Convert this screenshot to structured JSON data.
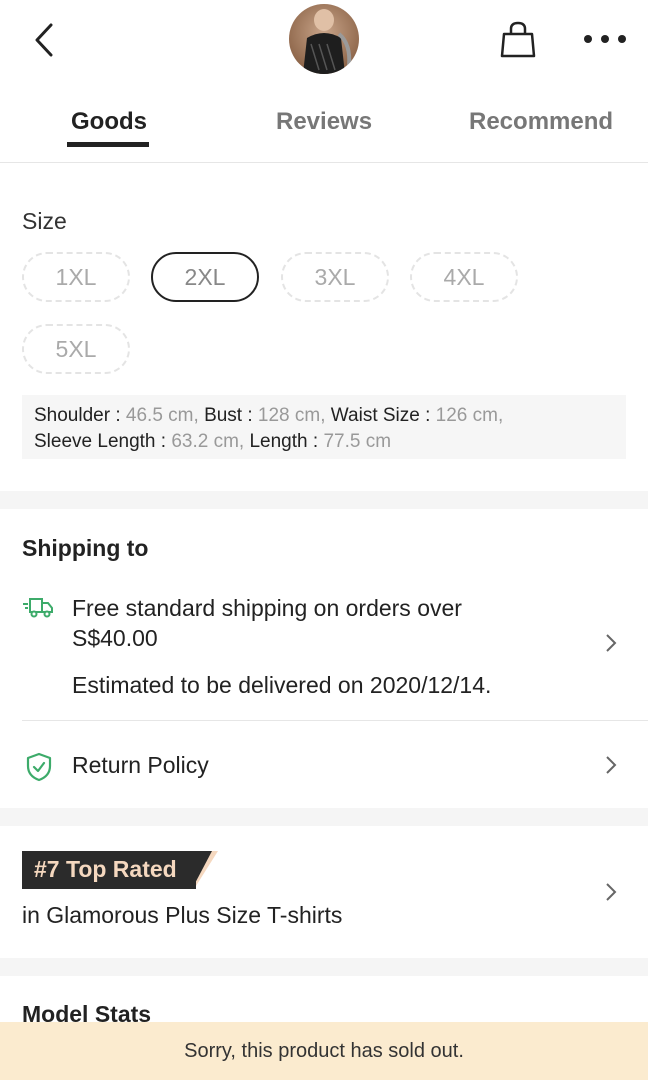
{
  "header": {
    "back_icon": "chevron-left-icon",
    "bag_icon": "shopping-bag-icon",
    "more_icon": "more-dots-icon"
  },
  "tabs": [
    {
      "label": "Goods",
      "active": true
    },
    {
      "label": "Reviews",
      "active": false
    },
    {
      "label": "Recommend",
      "active": false
    }
  ],
  "size": {
    "title": "Size",
    "options": [
      {
        "label": "1XL",
        "selected": false
      },
      {
        "label": "2XL",
        "selected": true
      },
      {
        "label": "3XL",
        "selected": false
      },
      {
        "label": "4XL",
        "selected": false
      },
      {
        "label": "5XL",
        "selected": false
      }
    ],
    "measurements": {
      "shoulder_label": "Shoulder :",
      "shoulder_value": "46.5 cm,",
      "bust_label": "Bust :",
      "bust_value": "128 cm,",
      "waist_label": "Waist Size :",
      "waist_value": "126 cm,",
      "sleeve_label": "Sleeve Length :",
      "sleeve_value": "63.2 cm,",
      "length_label": "Length :",
      "length_value": "77.5 cm"
    }
  },
  "shipping": {
    "title": "Shipping to",
    "free_shipping": "Free standard shipping on orders over S$40.00",
    "estimate": "Estimated to be delivered on 2020/12/14.",
    "return_policy": "Return Policy",
    "accent_color": "#3dab6a"
  },
  "ranking": {
    "badge": "#7 Top Rated",
    "category": "in Glamorous Plus Size T-shirts"
  },
  "model_stats": {
    "title": "Model Stats"
  },
  "sold_out": {
    "message": "Sorry, this product has sold out."
  }
}
